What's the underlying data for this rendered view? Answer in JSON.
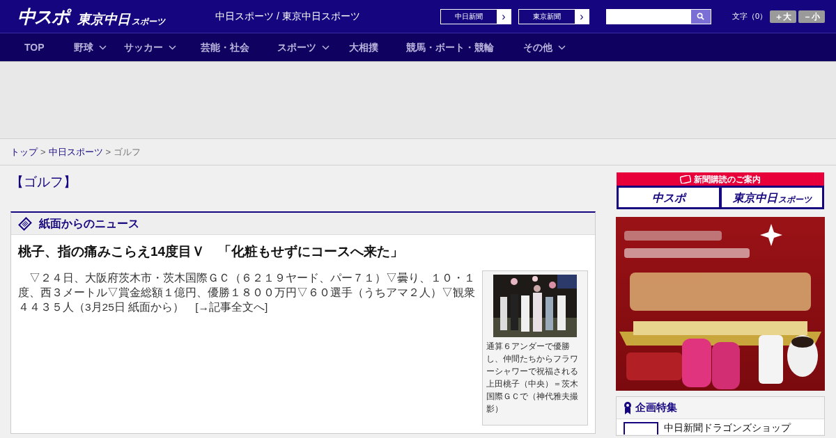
{
  "header": {
    "logo_main": "中スポ",
    "logo_sub": "東京中日",
    "logo_sub_small": "スポーツ",
    "site_title": "中日スポーツ / 東京中日スポーツ",
    "paper_links": [
      {
        "label": "中日新聞",
        "arrow": "›"
      },
      {
        "label": "東京新聞",
        "arrow": "›"
      }
    ],
    "font_size_label": "文字（0）",
    "font_buttons": [
      "＋大",
      "－小"
    ]
  },
  "nav": {
    "items": [
      {
        "label": "TOP",
        "has_dropdown": false
      },
      {
        "label": "野球",
        "has_dropdown": true
      },
      {
        "label": "サッカー",
        "has_dropdown": true
      },
      {
        "label": "芸能・社会",
        "has_dropdown": false
      },
      {
        "label": "スポーツ",
        "has_dropdown": true
      },
      {
        "label": "大相撲",
        "has_dropdown": false
      },
      {
        "label": "競馬・ボート・競輪",
        "has_dropdown": false
      },
      {
        "label": "その他",
        "has_dropdown": true
      }
    ]
  },
  "breadcrumb": [
    {
      "kind": "link",
      "label": "トップ"
    },
    {
      "kind": "separator",
      "label": ">"
    },
    {
      "kind": "link",
      "label": "中日スポーツ"
    },
    {
      "kind": "separator",
      "label": ">"
    },
    {
      "kind": "current",
      "label": "ゴルフ"
    }
  ],
  "category": "【ゴルフ】",
  "news_section": {
    "title": "紙面からのニュース",
    "headline": "桃子、指の痛みこらえ14度目Ｖ　「化粧もせずにコースへ来た」",
    "body": "　▽２４日、大阪府茨木市・茨木国際ＧＣ（６２１９ヤード、パー７１）▽曇り、１０・１度、西３メートル▽賞金総額１億円、優勝１８００万円▽６０選手（うちアマ２人）▽観衆４４３５人（3月25日 紙面から）",
    "more_link": "[→記事全文へ]",
    "caption": "通算６アンダーで優勝し、仲間たちからフラワーシャワーで祝福される上田桃子（中央）＝茨木国際ＧＣで（神代雅夫撮影）"
  },
  "sidebar": {
    "subscription": {
      "title": "新聞購読のご案内",
      "logos": [
        "中スポ",
        "東京中日"
      ],
      "logo_small": "スポーツ"
    },
    "feature": {
      "title": "企画特集",
      "items": [
        "中日新聞ドラゴンズショップ"
      ]
    }
  }
}
